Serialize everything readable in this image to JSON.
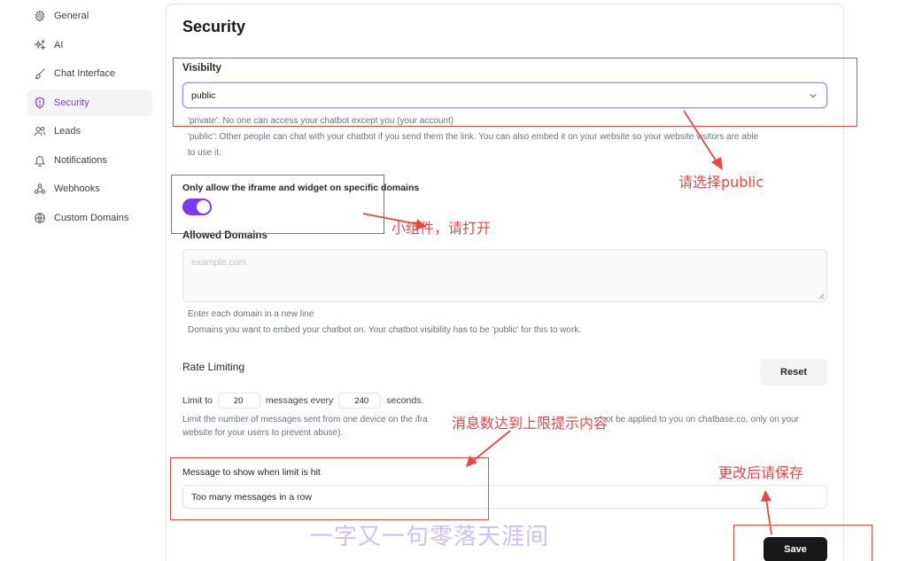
{
  "sidebar": {
    "items": [
      {
        "label": "General",
        "icon": "gear-icon"
      },
      {
        "label": "AI",
        "icon": "sparkles-icon"
      },
      {
        "label": "Chat Interface",
        "icon": "brush-icon"
      },
      {
        "label": "Security",
        "icon": "shield-icon",
        "active": true
      },
      {
        "label": "Leads",
        "icon": "users-icon"
      },
      {
        "label": "Notifications",
        "icon": "bell-icon"
      },
      {
        "label": "Webhooks",
        "icon": "webhook-icon"
      },
      {
        "label": "Custom Domains",
        "icon": "globe-icon"
      }
    ]
  },
  "security": {
    "title": "Security",
    "visibility": {
      "label": "Visibilty",
      "value": "public",
      "help_private": "'private': No one can access your chatbot except you (your account)",
      "help_public_1": "'public': Other people can chat with your chatbot if you send them the link. You can also embed it on your website so your website visitors are able",
      "help_public_2": "to use it."
    },
    "iframe": {
      "label": "Only allow the iframe and widget on specific domains",
      "enabled": true
    },
    "allowed_domains": {
      "label": "Allowed Domains",
      "placeholder": "example.com",
      "help_1": "Enter each domain in a new line",
      "help_2": "Domains you want to embed your chatbot on. Your chatbot visibility has to be 'public' for this to work."
    },
    "rate_limiting": {
      "label": "Rate Limiting",
      "reset_label": "Reset",
      "prefix": "Limit to",
      "messages_value": "20",
      "middle": "messages every",
      "seconds_value": "240",
      "suffix": "seconds.",
      "help_1": "Limit the number of messages sent from one device on the ifra",
      "help_1_tail": "ot be applied to you on chatbase.co, only on your",
      "help_2": "website for your users to prevent abuse)."
    },
    "limit_message": {
      "label": "Message to show when limit is hit",
      "value": "Too many messages in a row"
    },
    "save_label": "Save"
  },
  "annotations": {
    "color": "#ef4444",
    "choose_public": "请选择public",
    "widget_open": "小组件，请打开",
    "limit_hint": "消息数达到上限提示内容",
    "save_after_change": "更改后请保存",
    "watermark": "一字又一句零落天涯间"
  },
  "colors": {
    "accent": "#7c3aed",
    "save_button": "#18181b"
  }
}
